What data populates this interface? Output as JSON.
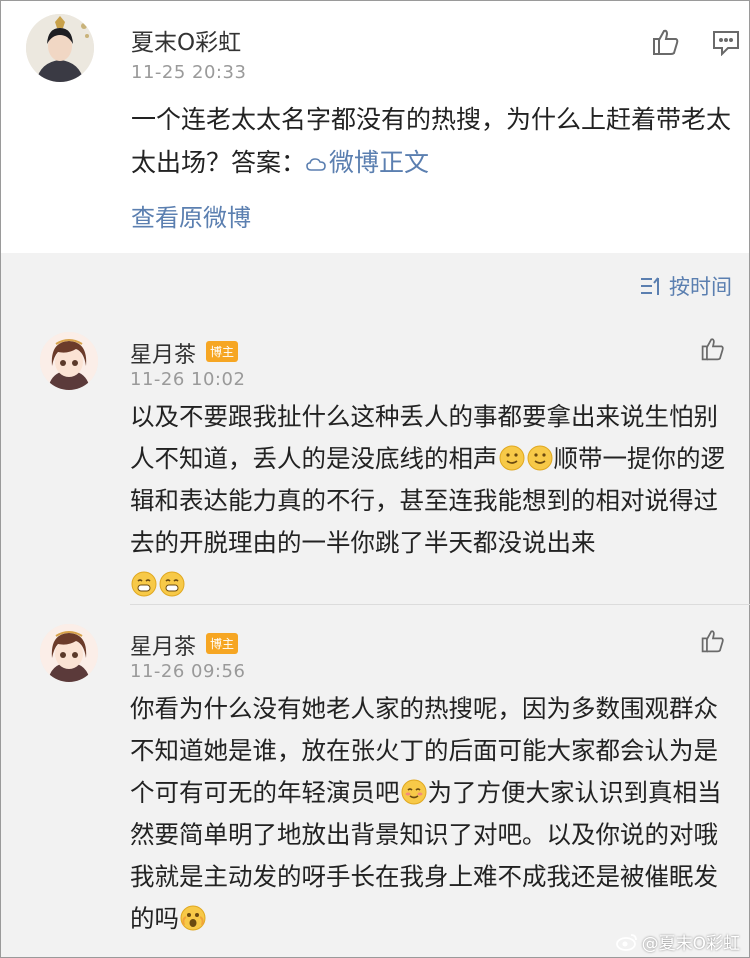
{
  "post": {
    "author": "夏末O彩虹",
    "time": "11-25 20:33",
    "text": "一个连老太太名字都没有的热搜，为什么上赶着带老太太出场？答案：",
    "link_label": "微博正文",
    "view_original": "查看原微博"
  },
  "sort": {
    "label": "按时间"
  },
  "comments": [
    {
      "author": "星月茶",
      "badge": "博主",
      "time": "11-26 10:02",
      "text_1": "以及不要跟我扯什么这种丢人的事都要拿出来说生怕别人不知道，丢人的是没底线的相声",
      "text_2": "顺带一提你的逻辑和表达能力真的不行，甚至连我能想到的相对说得过去的开脱理由的一半你跳了半天都没说出来"
    },
    {
      "author": "星月茶",
      "badge": "博主",
      "time": "11-26 09:56",
      "text_1": "你看为什么没有她老人家的热搜呢，因为多数围观群众不知道她是谁，放在张火丁的后面可能大家都会认为是个可有可无的年轻演员吧",
      "text_2": "为了方便大家认识到真相当然要简单明了地放出背景知识了对吧。以及你说的对哦我就是主动发的呀手长在我身上难不成我还是被催眠发的吗"
    }
  ],
  "watermark": "@夏末O彩虹",
  "icons": [
    "like-icon",
    "comment-icon",
    "sort-icon",
    "smile-emoji",
    "grin-emoji",
    "blush-emoji",
    "scared-emoji",
    "weibo-logo-icon"
  ]
}
